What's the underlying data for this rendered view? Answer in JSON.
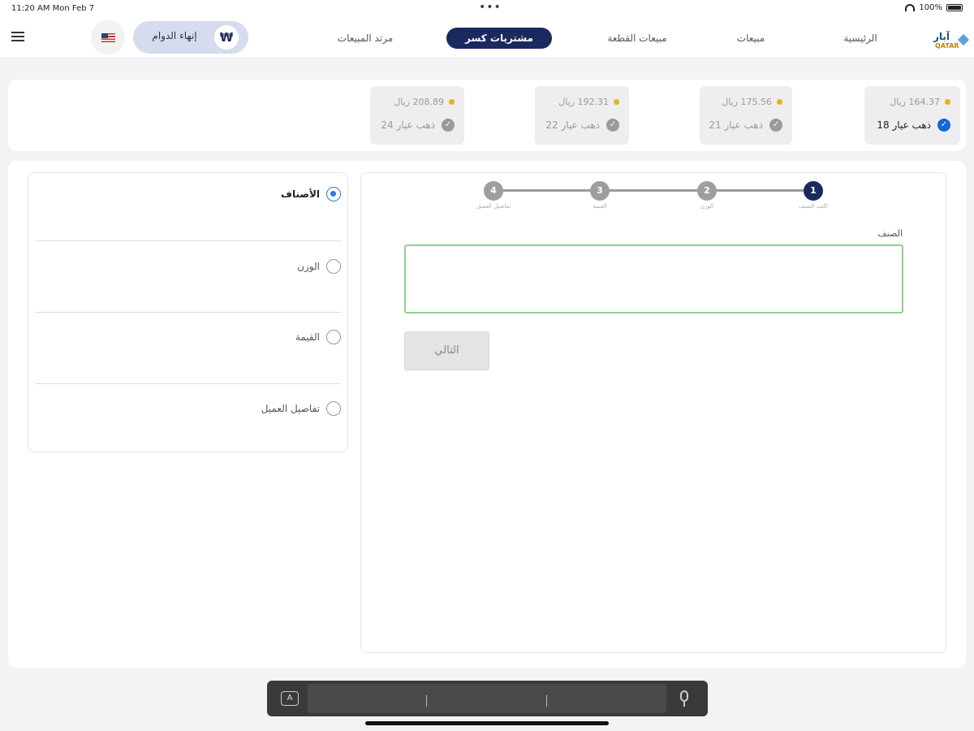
{
  "status_bar": {
    "time": "11:20 AM   Mon Feb 7",
    "dots": "•••",
    "battery": "100%"
  },
  "header": {
    "nav": [
      "الرئيسية",
      "مبيعات",
      "مبيعات القطعة",
      "مشتريات كسر",
      "مرتد المبيعات"
    ],
    "active_nav": "مشتريات كسر",
    "end_shift_label": "إنهاء الدوام",
    "end_shift_icon": "₩",
    "logo_text": "آبار",
    "logo_sub": "QATAR"
  },
  "prices": [
    {
      "price": "164.37 ريال",
      "karat": "ذهب عيار 18",
      "selected": true
    },
    {
      "price": "175.56 ريال",
      "karat": "ذهب عيار 21",
      "selected": false
    },
    {
      "price": "192.31 ريال",
      "karat": "ذهب عيار 22",
      "selected": false
    },
    {
      "price": "208.89 ريال",
      "karat": "ذهب عيار 24",
      "selected": false
    }
  ],
  "stepper": {
    "steps": [
      {
        "num": "1",
        "label": "اكتب الصنف",
        "active": true
      },
      {
        "num": "2",
        "label": "الوزن",
        "active": false
      },
      {
        "num": "3",
        "label": "القيمة",
        "active": false
      },
      {
        "num": "4",
        "label": "تفاصيل العميل",
        "active": false
      }
    ]
  },
  "form": {
    "field_label": "الصنف",
    "field_value": "",
    "next_label": "التالي"
  },
  "side_options": [
    {
      "label": "الأصناف",
      "selected": true
    },
    {
      "label": "الوزن",
      "selected": false
    },
    {
      "label": "القيمة",
      "selected": false
    },
    {
      "label": "تفاصيل العميل",
      "selected": false
    }
  ],
  "colors": {
    "primary": "#1a2a5e",
    "accent": "#1565d8",
    "gold": "#e8b21a",
    "field_border": "#8fd08a"
  },
  "icons": {
    "menu": "hamburger-icon",
    "flag": "us-flag-icon",
    "check": "check-circle-icon",
    "keyboard": "keyboard-icon",
    "mic": "microphone-icon"
  }
}
